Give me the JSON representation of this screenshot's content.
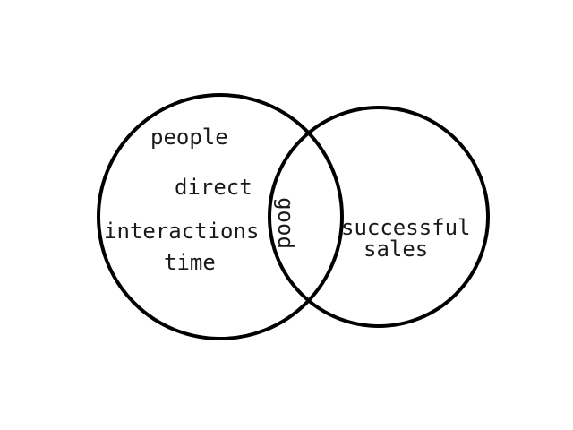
{
  "diagram": {
    "type": "venn",
    "line_color": "#000000",
    "background": "#ffffff",
    "left_circle": {
      "terms": [
        "people",
        "direct",
        "interactions",
        "time"
      ]
    },
    "overlap": {
      "terms": [
        "good"
      ]
    },
    "right_circle": {
      "terms": [
        "successful",
        "sales"
      ]
    }
  }
}
